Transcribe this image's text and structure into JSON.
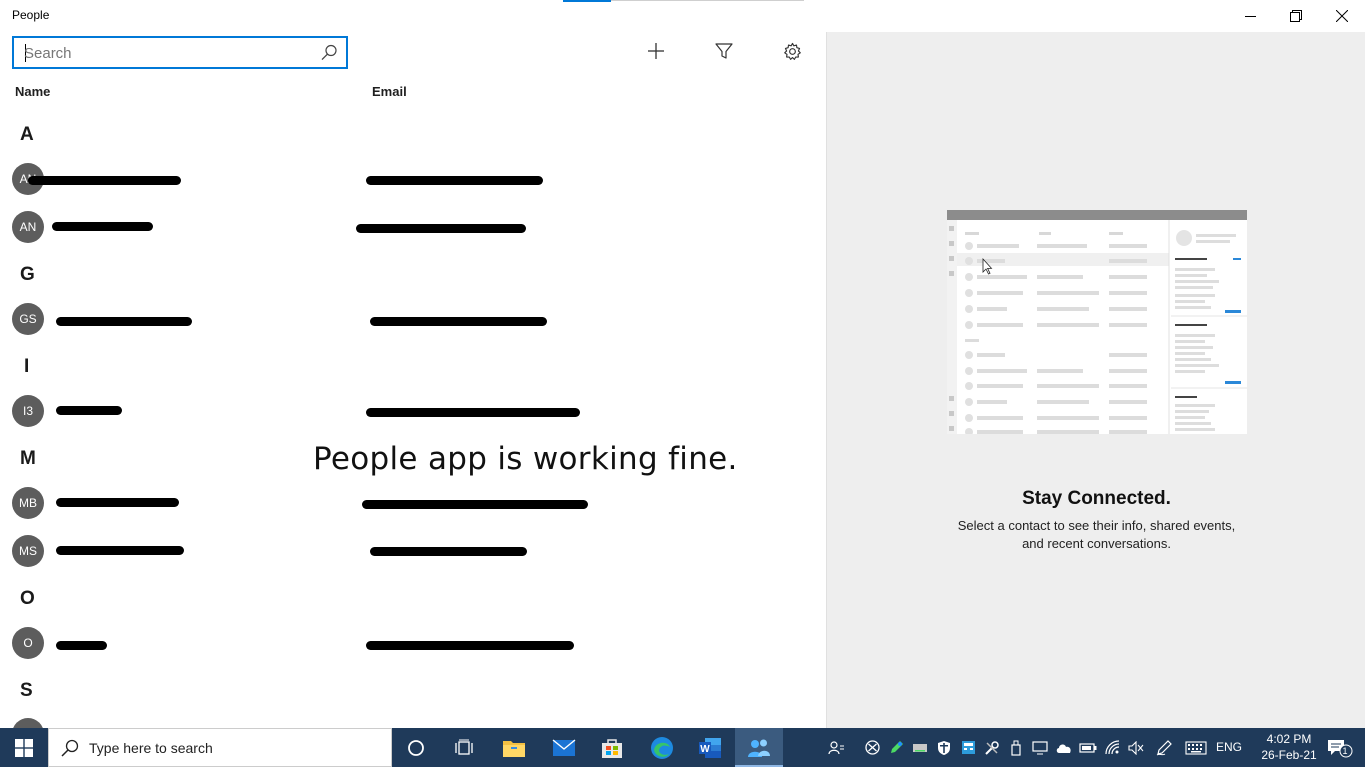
{
  "window": {
    "title": "People",
    "minimize_icon": "minimize-icon",
    "restore_icon": "restore-icon",
    "close_icon": "close-icon"
  },
  "search": {
    "placeholder": "Search",
    "value": ""
  },
  "toolbar": {
    "add_icon": "add-icon",
    "filter_icon": "filter-icon",
    "settings_icon": "gear-icon"
  },
  "columns": {
    "name": "Name",
    "email": "Email"
  },
  "groups": [
    {
      "letter": "A",
      "contacts": [
        {
          "initials": "AN"
        },
        {
          "initials": "AN"
        }
      ]
    },
    {
      "letter": "G",
      "contacts": [
        {
          "initials": "GS"
        }
      ]
    },
    {
      "letter": "I",
      "contacts": [
        {
          "initials": "I3"
        }
      ]
    },
    {
      "letter": "M",
      "contacts": [
        {
          "initials": "MB"
        },
        {
          "initials": "MS"
        }
      ]
    },
    {
      "letter": "O",
      "contacts": [
        {
          "initials": "O"
        }
      ]
    },
    {
      "letter": "S",
      "contacts": []
    }
  ],
  "overlay_caption": "People app is working fine.",
  "detail": {
    "title": "Stay Connected.",
    "text": "Select a contact to see their info, shared events, and recent conversations."
  },
  "taskbar": {
    "search_placeholder": "Type here to search",
    "language": "ENG",
    "time": "4:02 PM",
    "date": "26-Feb-21",
    "notification_count": "1"
  },
  "colors": {
    "accent": "#0078d7",
    "taskbar": "#1f3a5a",
    "avatar": "#5d5d5d",
    "pane": "#eeeeee"
  }
}
